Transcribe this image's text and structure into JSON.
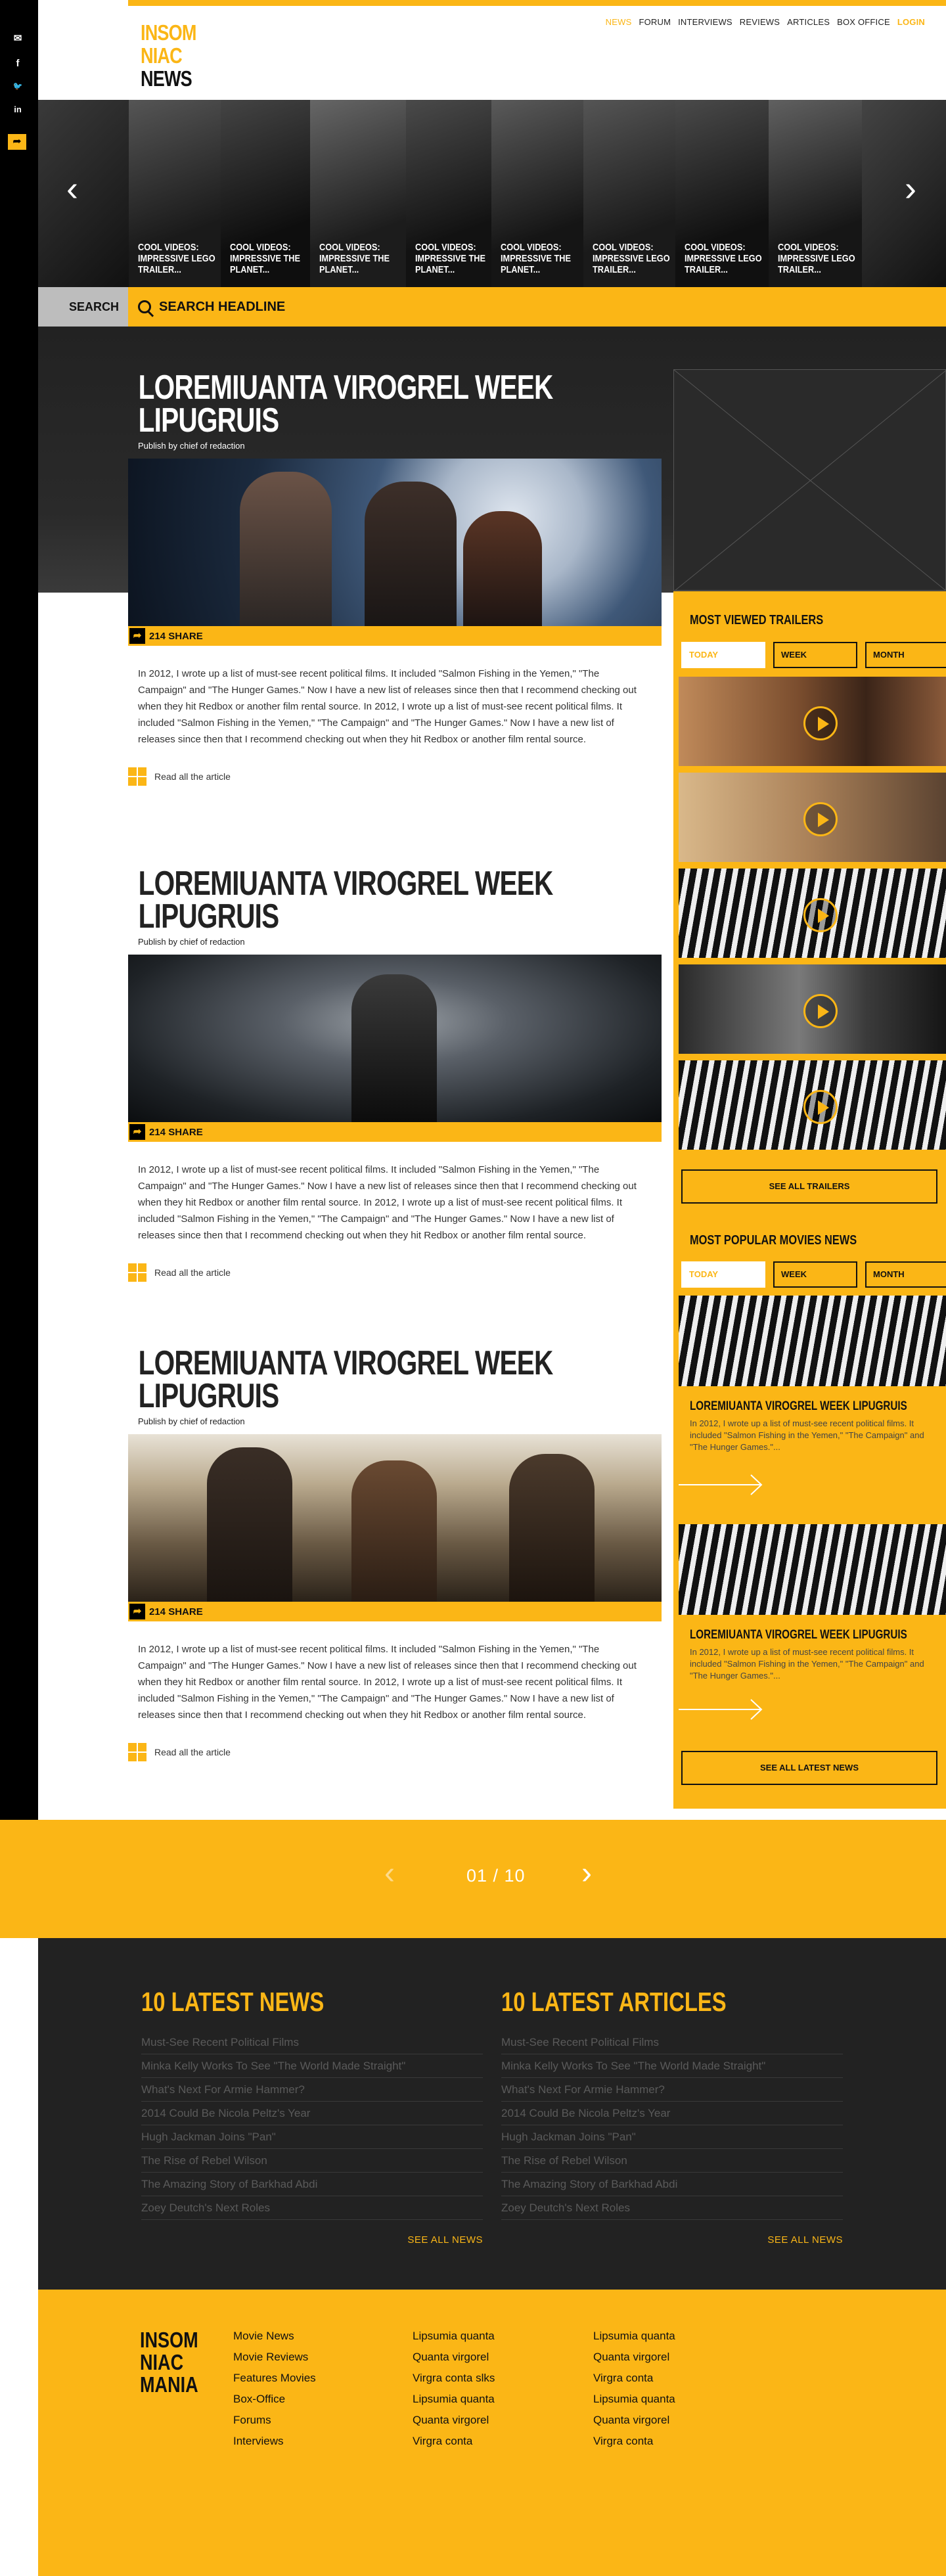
{
  "social": [
    "mail-icon",
    "facebook-icon",
    "twitter-icon",
    "linkedin-icon"
  ],
  "social_glyphs": [
    "✉",
    "f",
    "🐦",
    "in"
  ],
  "logo": {
    "l1": "INSOM",
    "l2": "NIAC",
    "l3": "NEWS"
  },
  "nav": {
    "items": [
      "NEWS",
      "FORUM",
      "INTERVIEWS",
      "REVIEWS",
      "ARTICLES",
      "BOX OFFICE"
    ],
    "login": "LOGIN"
  },
  "carousel": {
    "slides": [
      "COOL VIDEOS: IMPRESSIVE LEGO TRAILER...",
      "COOL VIDEOS: IMPRESSIVE THE PLANET...",
      "COOL VIDEOS: IMPRESSIVE THE PLANET...",
      "COOL VIDEOS: IMPRESSIVE THE PLANET...",
      "COOL VIDEOS: IMPRESSIVE THE PLANET...",
      "COOL VIDEOS: IMPRESSIVE LEGO TRAILER...",
      "COOL VIDEOS: IMPRESSIVE LEGO TRAILER...",
      "COOL VIDEOS: IMPRESSIVE LEGO TRAILER..."
    ],
    "prev": "‹",
    "next": "›"
  },
  "search": {
    "button": "SEARCH",
    "placeholder": "SEARCH HEADLINE"
  },
  "articles": [
    {
      "title": "LOREMIUANTA VIROGREL WEEK LIPUGRUIS",
      "by": "Publish by chief of redaction",
      "shares": "214 SHARE",
      "body": "In 2012, I wrote up a list of must-see recent political films. It included \"Salmon Fishing in the Yemen,\" \"The Campaign\" and \"The Hunger Games.\"  Now I have a new list of releases since then that I recommend checking out when they hit Redbox or another film rental source. In 2012, I wrote up a list of must-see recent political films. It included \"Salmon Fishing in the Yemen,\" \"The Campaign\" and \"The Hunger Games.\" Now I have a new list of releases since then that I recommend checking out when they hit Redbox or another film rental source.",
      "read": "Read all the article"
    },
    {
      "title": "LOREMIUANTA VIROGREL WEEK LIPUGRUIS",
      "by": "Publish by chief of redaction",
      "shares": "214 SHARE",
      "body": "In 2012, I wrote up a list of must-see recent political films. It included \"Salmon Fishing in the Yemen,\" \"The Campaign\" and \"The Hunger Games.\"  Now I have a new list of releases since then that I recommend checking out when they hit Redbox or another film rental source. In 2012, I wrote up a list of must-see recent political films. It included \"Salmon Fishing in the Yemen,\" \"The Campaign\" and \"The Hunger Games.\" Now I have a new list of releases since then that I recommend checking out when they hit Redbox or another film rental source.",
      "read": "Read all the article"
    },
    {
      "title": "LOREMIUANTA VIROGREL WEEK LIPUGRUIS",
      "by": "Publish by chief of redaction",
      "shares": "214 SHARE",
      "body": "In 2012, I wrote up a list of must-see recent political films. It included \"Salmon Fishing in the Yemen,\" \"The Campaign\" and \"The Hunger Games.\"  Now I have a new list of releases since then that I recommend checking out when they hit Redbox or another film rental source. In 2012, I wrote up a list of must-see recent political films. It included \"Salmon Fishing in the Yemen,\" \"The Campaign\" and \"The Hunger Games.\" Now I have a new list of releases since then that I recommend checking out when they hit Redbox or another film rental source.",
      "read": "Read all the article"
    }
  ],
  "sidebar": {
    "trailers_title": "MOST VIEWED TRAILERS",
    "tabs": [
      "TODAY",
      "WEEK",
      "MONTH"
    ],
    "see_all_trailers": "SEE ALL TRAILERS",
    "popular_title": "MOST POPULAR MOVIES NEWS",
    "popular": [
      {
        "title": "LOREMIUANTA VIROGREL WEEK LIPUGRUIS",
        "text": "In 2012, I wrote up a list of must-see recent political films. It included \"Salmon Fishing in the Yemen,\" \"The Campaign\" and \"The Hunger Games.\"..."
      },
      {
        "title": "LOREMIUANTA VIROGREL WEEK LIPUGRUIS",
        "text": "In 2012, I wrote up a list of must-see recent political films. It included \"Salmon Fishing in the Yemen,\" \"The Campaign\" and \"The Hunger Games.\"..."
      }
    ],
    "see_all_news": "SEE ALL LATEST NEWS"
  },
  "pager": {
    "label": "01 / 10",
    "prev": "‹",
    "next": "›"
  },
  "latest_news": {
    "title": "10 LATEST NEWS",
    "items": [
      "Must-See Recent Political Films",
      "Minka Kelly Works To See \"The World Made Straight\"",
      "What's Next For Armie Hammer?",
      "2014 Could Be Nicola Peltz's Year",
      "Hugh Jackman Joins \"Pan\"",
      "The Rise of Rebel Wilson",
      "The Amazing Story of Barkhad Abdi",
      "Zoey Deutch's Next Roles"
    ],
    "see_all": "SEE ALL NEWS"
  },
  "latest_articles": {
    "title": "10 LATEST ARTICLES",
    "items": [
      "Must-See Recent Political Films",
      "Minka Kelly Works To See \"The World Made Straight\"",
      "What's Next For Armie Hammer?",
      "2014 Could Be Nicola Peltz's Year",
      "Hugh Jackman Joins \"Pan\"",
      "The Rise of Rebel Wilson",
      "The Amazing Story of Barkhad Abdi",
      "Zoey Deutch's Next Roles"
    ],
    "see_all": "SEE ALL NEWS"
  },
  "footer": {
    "logo": {
      "l1": "INSOM",
      "l2": "NIAC",
      "l3": "MANIA"
    },
    "col1": [
      "Movie News",
      "Movie Reviews",
      "Features Movies",
      "Box-Office",
      "Forums",
      "Interviews"
    ],
    "col2": [
      "Lipsumia quanta",
      "Quanta virgorel",
      "Virgra conta slks",
      "Lipsumia quanta",
      "Quanta virgorel",
      "Virgra conta"
    ],
    "col3": [
      "Lipsumia quanta",
      "Quanta virgorel",
      "Virgra conta",
      "Lipsumia quanta",
      "Quanta virgorel",
      "Virgra conta"
    ]
  },
  "colors": {
    "accent": "#fbb616",
    "dark": "#222222",
    "black": "#000000"
  }
}
